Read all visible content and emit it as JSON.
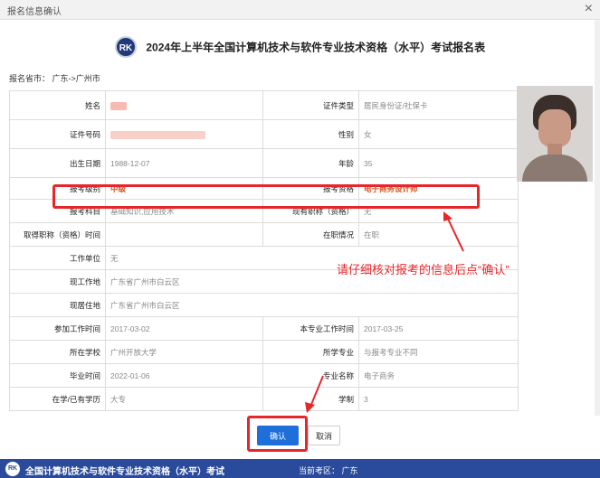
{
  "dialog": {
    "title": "报名信息确认",
    "close": "×"
  },
  "form": {
    "logo_text": "RK",
    "title": "2024年上半年全国计算机技术与软件专业技术资格（水平）考试报名表",
    "province_label": "报名省市：",
    "province_value": "广东->广州市"
  },
  "rows": {
    "name_label": "姓名",
    "id_type_label": "证件类型",
    "id_type_value": "居民身份证/社保卡",
    "id_number_label": "证件号码",
    "gender_label": "性别",
    "gender_value": "女",
    "birth_label": "出生日期",
    "birth_value": "1988-12-07",
    "age_label": "年龄",
    "age_value": "35",
    "level_label": "报考级别",
    "level_value": "中级",
    "qual_label": "报考资格",
    "qual_value": "电子商务设计师",
    "subject_label": "报考科目",
    "subject_value": "基础知识,应用技术",
    "current_title_label": "现有职称（资格）",
    "current_title_value": "无",
    "title_time_label": "取得职称（资格）时间",
    "title_time_value": "",
    "employment_label": "在职情况",
    "employment_value": "在职",
    "employer_label": "工作单位",
    "employer_value": "无",
    "work_place_label": "现工作地",
    "work_place_value": "广东省广州市白云区",
    "residence_label": "现居住地",
    "residence_value": "广东省广州市白云区",
    "work_start_label": "参加工作时间",
    "work_start_value": "2017-03-02",
    "major_work_start_label": "本专业工作时间",
    "major_work_start_value": "2017-03-25",
    "school_label": "所在学校",
    "school_value": "广州开放大学",
    "school_major_label": "所学专业",
    "school_major_value": "与报考专业不同",
    "grad_time_label": "毕业时间",
    "grad_time_value": "2022-01-06",
    "major_name_label": "专业名称",
    "major_name_value": "电子商务",
    "degree_label": "在学/已有学历",
    "degree_value": "大专",
    "duration_label": "学制",
    "duration_value": "3"
  },
  "annotation": {
    "notice": "请仔细核对报考的信息后点“确认”"
  },
  "buttons": {
    "confirm": "确认",
    "cancel": "取消"
  },
  "footer": {
    "logo_text": "RK",
    "title": "全国计算机技术与软件专业技术资格（水平）考试",
    "region": "当前考区：  广东"
  },
  "colors": {
    "accent": "#1e6fd9",
    "highlight": "#e8262a",
    "orange_value": "#d9541e",
    "footer_bg": "#2a4b9b"
  }
}
